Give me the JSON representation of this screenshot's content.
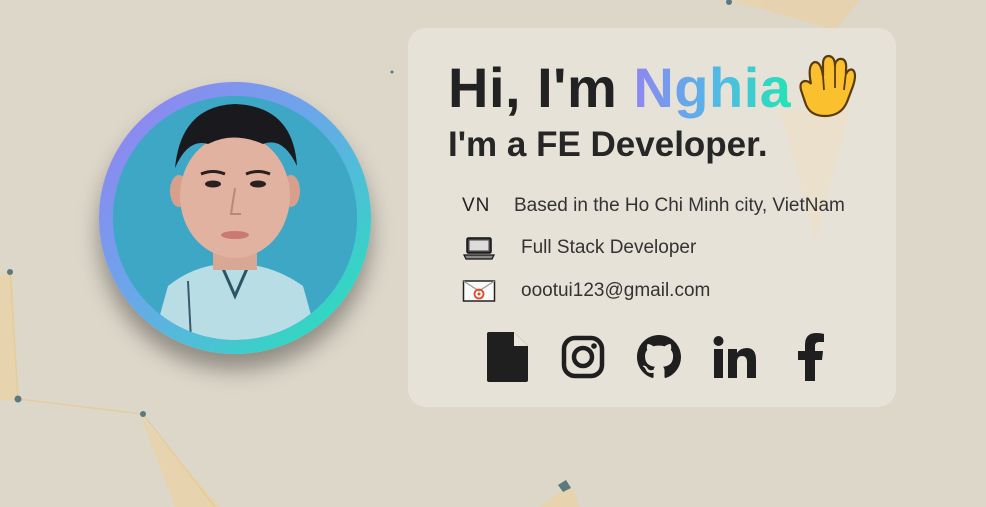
{
  "hero": {
    "greeting_prefix": "Hi, I'm",
    "name": "Nghia",
    "wave_icon": "waving-hand-icon",
    "role": "I'm a FE Developer."
  },
  "info": {
    "location_code": "VN",
    "location": "Based in the Ho Chi Minh city, VietNam",
    "job": "Full Stack Developer",
    "email": "oootui123@gmail.com"
  },
  "icons": {
    "job": "laptop-icon",
    "email": "envelope-icon"
  },
  "socials": [
    {
      "icon": "document-icon"
    },
    {
      "icon": "instagram-icon"
    },
    {
      "icon": "github-icon"
    },
    {
      "icon": "linkedin-icon"
    },
    {
      "icon": "facebook-icon"
    }
  ],
  "colors": {
    "background": "#ddd7ca",
    "name_gradient": [
      "#8f86f0",
      "#55b6e8",
      "#24e3b5"
    ],
    "ring_gradient": [
      "#9b7cf2",
      "#6aa7ea",
      "#1ee8b4"
    ],
    "text": "#222222"
  }
}
